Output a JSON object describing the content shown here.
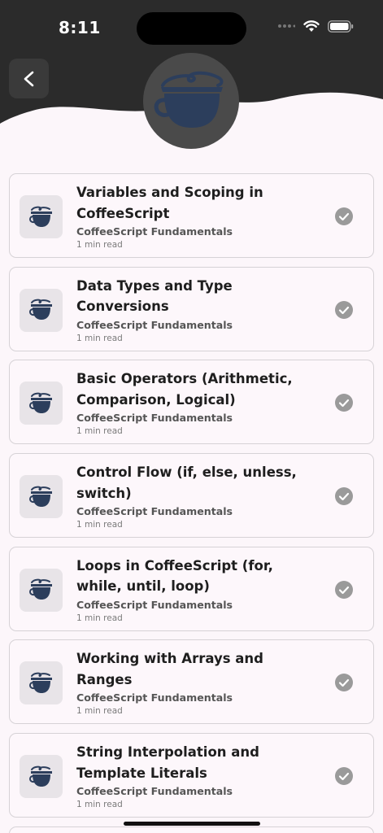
{
  "status_bar": {
    "time": "8:11"
  },
  "colors": {
    "header_bg": "#2b2b2b",
    "accent": "#2c3e5c",
    "page_bg": "#fcf6fa",
    "check": "#9a9a9a"
  },
  "icons": {
    "back": "chevron-left-icon",
    "logo": "coffee-cup-icon",
    "status": "check-circle-icon"
  },
  "lessons": [
    {
      "title": "Variables and Scoping in CoffeeScript",
      "course": "CoffeeScript Fundamentals",
      "read_time": "1 min read",
      "completed": true
    },
    {
      "title": "Data Types and Type Conversions",
      "course": "CoffeeScript Fundamentals",
      "read_time": "1 min read",
      "completed": true
    },
    {
      "title": "Basic Operators (Arithmetic, Comparison, Logical)",
      "course": "CoffeeScript Fundamentals",
      "read_time": "1 min read",
      "completed": true
    },
    {
      "title": "Control Flow (if, else, unless, switch)",
      "course": "CoffeeScript Fundamentals",
      "read_time": "1 min read",
      "completed": true
    },
    {
      "title": "Loops in CoffeeScript (for, while, until, loop)",
      "course": "CoffeeScript Fundamentals",
      "read_time": "1 min read",
      "completed": true
    },
    {
      "title": "Working with Arrays and Ranges",
      "course": "CoffeeScript Fundamentals",
      "read_time": "1 min read",
      "completed": true
    },
    {
      "title": "String Interpolation and Template Literals",
      "course": "CoffeeScript Fundamentals",
      "read_time": "1 min read",
      "completed": true
    }
  ]
}
